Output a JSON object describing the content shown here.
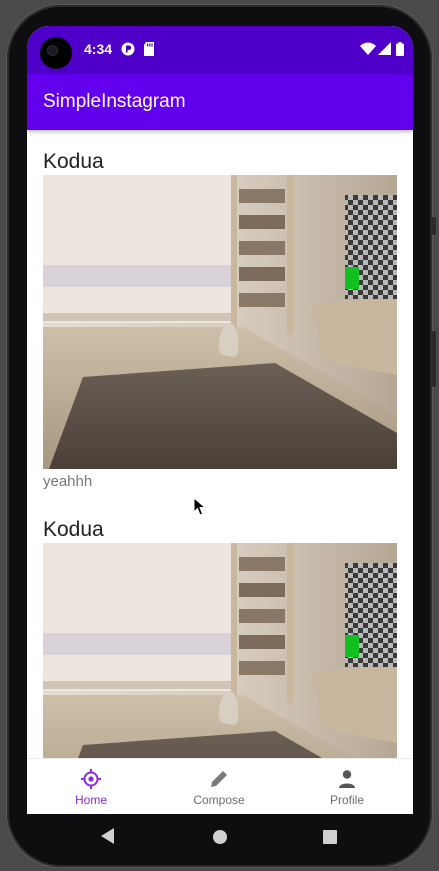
{
  "status_bar": {
    "time": "4:34",
    "icons": [
      "camera-cutout-icon",
      "notification-p-icon",
      "sd-card-icon",
      "wifi-icon",
      "signal-icon",
      "battery-icon"
    ]
  },
  "app_bar": {
    "title": "SimpleInstagram"
  },
  "posts": [
    {
      "username": "Kodua",
      "caption": "yeahhh",
      "image": "room-with-cat-photo"
    },
    {
      "username": "Kodua",
      "caption": "",
      "image": "room-with-cat-photo"
    }
  ],
  "bottom_nav": {
    "items": [
      {
        "label": "Home",
        "icon": "home-icon",
        "active": true
      },
      {
        "label": "Compose",
        "icon": "pencil-icon",
        "active": false
      },
      {
        "label": "Profile",
        "icon": "person-icon",
        "active": false
      }
    ]
  },
  "system_nav": {
    "icons": [
      "back-icon",
      "home-circle-icon",
      "recents-icon"
    ]
  },
  "colors": {
    "status_bar": "#4f00c8",
    "app_bar": "#6200ee",
    "active_nav": "#8a2be2",
    "inactive_nav": "#6d6d6d"
  }
}
